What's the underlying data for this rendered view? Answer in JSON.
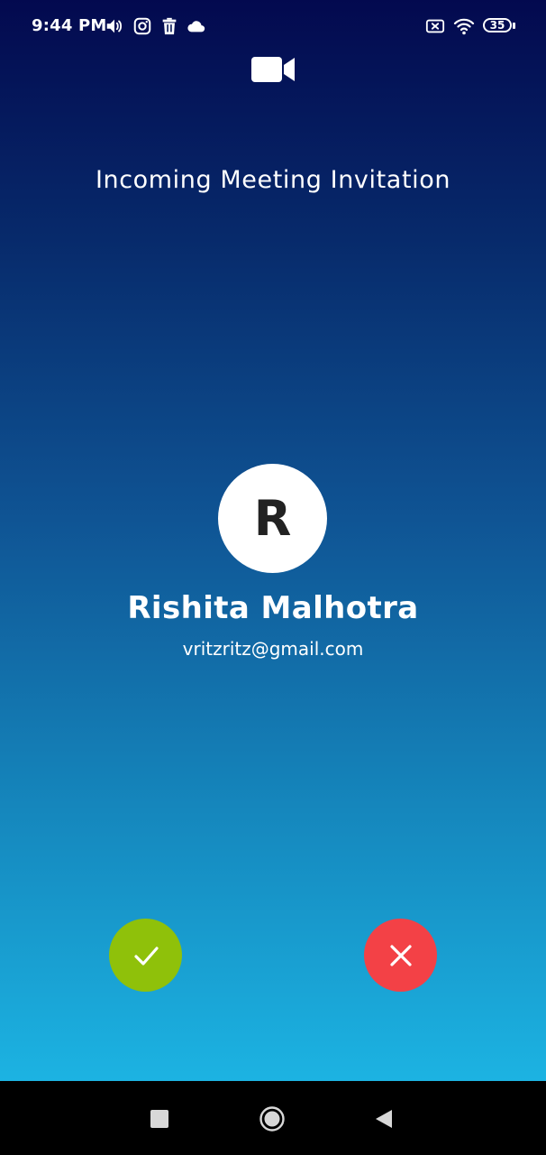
{
  "status_bar": {
    "time": "9:44 PM",
    "icons": [
      "volume-icon",
      "instagram-icon",
      "trash-icon",
      "cloud-icon",
      "no-sim-icon",
      "wifi-icon"
    ],
    "battery_level": "35"
  },
  "header": {
    "icon": "video-camera-icon",
    "title": "Incoming Meeting Invitation"
  },
  "caller": {
    "initial": "R",
    "name": "Rishita Malhotra",
    "email": "vritzritz@gmail.com"
  },
  "actions": {
    "accept_icon": "check-icon",
    "decline_icon": "close-icon"
  },
  "navigation": {
    "icons": [
      "recents-icon",
      "home-icon",
      "back-icon"
    ]
  },
  "colors": {
    "gradient_top": "#03094f",
    "gradient_bottom": "#1cb3e2",
    "accept": "#8fc10a",
    "decline": "#f34146",
    "nav_bar": "#000000"
  }
}
